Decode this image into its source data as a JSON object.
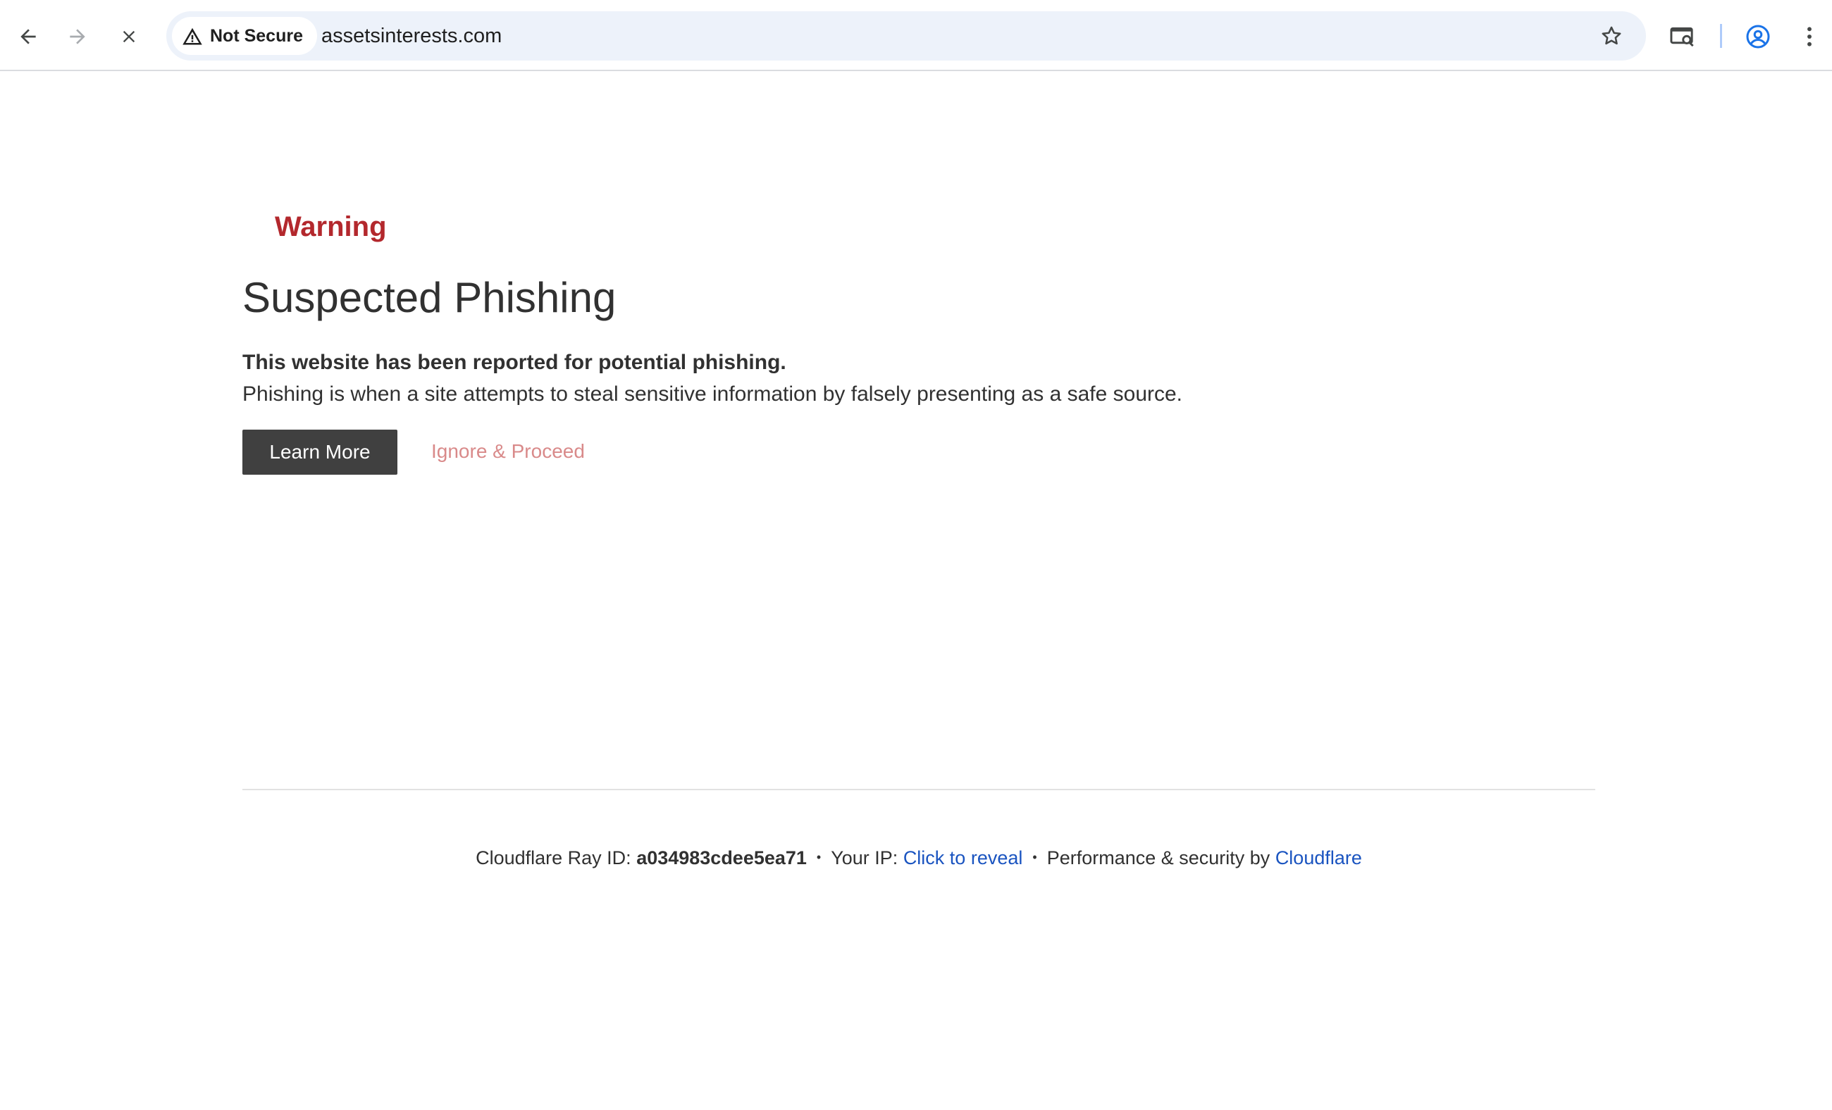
{
  "browser": {
    "security_chip_label": "Not Secure",
    "url": "assetsinterests.com",
    "icons": {
      "back": "back-arrow-icon",
      "forward": "forward-arrow-icon",
      "stop": "close-icon",
      "warning": "warning-triangle-icon",
      "bookmark": "star-icon",
      "page_search": "page-search-icon",
      "profile": "profile-icon",
      "menu": "vertical-dots-icon"
    },
    "colors": {
      "omnibox_bg": "#edf2fa",
      "profile_blue": "#1a73e8"
    }
  },
  "page": {
    "warning_label": "Warning",
    "heading": "Suspected Phishing",
    "subheading": "This website has been reported for potential phishing.",
    "description": "Phishing is when a site attempts to steal sensitive information by falsely presenting as a safe source.",
    "learn_more_label": "Learn More",
    "ignore_label": "Ignore & Proceed",
    "colors": {
      "warning_red": "#b3282d",
      "button_dark": "#404040",
      "ignore_pink": "#d98a8a",
      "link_blue": "#1a54c0"
    }
  },
  "footer": {
    "ray_prefix": "Cloudflare Ray ID: ",
    "ray_id": "a034983cdee5ea71",
    "separator": "•",
    "ip_prefix": "Your IP: ",
    "ip_link": "Click to reveal",
    "perf_prefix": "Performance & security by ",
    "cloudflare_link": "Cloudflare"
  }
}
